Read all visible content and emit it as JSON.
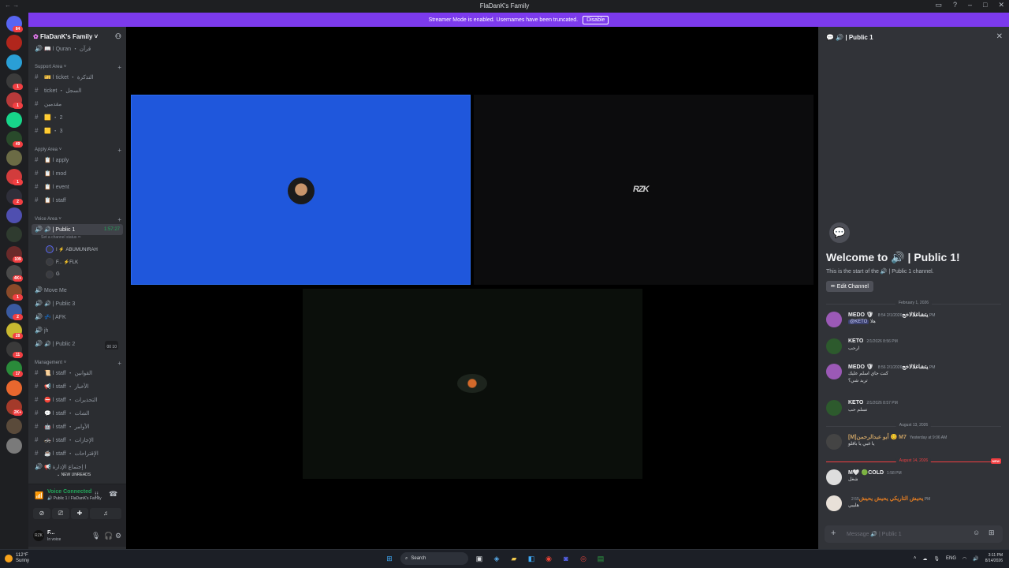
{
  "window": {
    "title": "FlaDanK's Family",
    "nav": "← →",
    "controls": [
      "▭",
      "?",
      "–",
      "□",
      "✕"
    ]
  },
  "banner": {
    "text": "Streamer Mode is enabled. Usernames have been truncated.",
    "button": "Disable"
  },
  "servers": [
    {
      "badge": "84",
      "color": "#5865f2"
    },
    {
      "badge": "",
      "color": "#b1261c"
    },
    {
      "badge": "",
      "color": "#2a9fd6"
    },
    {
      "badge": "1",
      "color": "#3b3b3b"
    },
    {
      "badge": "1",
      "color": "#b73a3a"
    },
    {
      "badge": "",
      "color": "#17d58a"
    },
    {
      "badge": "49",
      "color": "#294a2b"
    },
    {
      "badge": "",
      "color": "#6b6b45"
    },
    {
      "badge": "1",
      "color": "#d23c3c"
    },
    {
      "badge": "2",
      "color": "#2f2f3a"
    },
    {
      "badge": "",
      "color": "#4f4fb0"
    },
    {
      "badge": "",
      "color": "#2f3b2f"
    },
    {
      "badge": "109",
      "color": "#6a2a2a"
    },
    {
      "badge": "4K+",
      "color": "#4a4a4a"
    },
    {
      "badge": "1",
      "color": "#8a4a2a"
    },
    {
      "badge": "2",
      "color": "#3a5aa0"
    },
    {
      "badge": "28",
      "color": "#c8b830"
    },
    {
      "badge": "11",
      "color": "#3a3a3a"
    },
    {
      "badge": "17",
      "color": "#2a8a3a"
    },
    {
      "badge": "",
      "color": "#e8672e"
    },
    {
      "badge": "2K+",
      "color": "#a43a2a"
    },
    {
      "badge": "",
      "color": "#5a4a3a"
    },
    {
      "badge": "",
      "color": "#7a7a7a"
    }
  ],
  "sidebar": {
    "server_name": "FlaDanK's Family",
    "invite_icon": "add-user-icon",
    "top_channel": {
      "prefix": "🔊",
      "name": "📖 ا Quran ・ قرآن"
    },
    "categories": [
      {
        "name": "Support Area",
        "channels": [
          {
            "prefix": "#",
            "name": "🎫 ا ticket ・ التذكرة"
          },
          {
            "prefix": "#",
            "name": "ticket ・ السجل"
          },
          {
            "prefix": "#",
            "name": "مقدمين"
          },
          {
            "prefix": "#",
            "name": "🟨 ・ 2"
          },
          {
            "prefix": "#",
            "name": "🟨 ・ 3"
          }
        ]
      },
      {
        "name": "Apply Area",
        "channels": [
          {
            "prefix": "#",
            "name": "📋 ا apply"
          },
          {
            "prefix": "#",
            "name": "📋 ا mod"
          },
          {
            "prefix": "#",
            "name": "📋 ا event"
          },
          {
            "prefix": "#",
            "name": "📋 ا staff"
          }
        ]
      },
      {
        "name": "Voice Area",
        "channels": []
      },
      {
        "name": "Management",
        "channels": [
          {
            "prefix": "#",
            "name": "📜 ا staff ・ القوانين"
          },
          {
            "prefix": "#",
            "name": "📢 ا staff ・ الأخبار"
          },
          {
            "prefix": "#",
            "name": "⛔ ا staff ・ التحذيرات"
          },
          {
            "prefix": "#",
            "name": "💬 ا staff ・ الشات"
          },
          {
            "prefix": "#",
            "name": "🤖 ا staff ・ الأوامر"
          },
          {
            "prefix": "#",
            "name": "🚓 ا staff ・ الإجازات"
          },
          {
            "prefix": "#",
            "name": "☕ ا staff ・ الإقتراحات"
          },
          {
            "prefix": "🔊",
            "name": "📢 ا إجتماع الإدارة"
          }
        ]
      }
    ],
    "active_voice": {
      "name": "🔊 | Public 1",
      "timer": "1:57:27",
      "status": "Set a channel status ✏",
      "users": [
        "ا ⚡ ABUMUNIRAH",
        "F... ⚡FLK",
        "G"
      ]
    },
    "other_voice": [
      {
        "name": "Move Me"
      },
      {
        "name": "🔊 | Public 3"
      },
      {
        "name": "💤 | AFK"
      },
      {
        "name": "jh"
      },
      {
        "name": "🔊 | Public 2",
        "limit": "00 10"
      }
    ],
    "new_unreads": "NEW UNREADS"
  },
  "voice_panel": {
    "title": "Voice Connected",
    "subtitle": "🔊 Public 1 / FlaDanK's Family"
  },
  "user": {
    "name": "F...",
    "status": "In voice",
    "avatar_text": "RZK"
  },
  "stage": {
    "rzk_logo": "RZK"
  },
  "chat": {
    "header": "🔊 | Public 1",
    "welcome": "Welcome to 🔊 | Public 1!",
    "welcome_sub": "This is the start of the 🔊 | Public 1 channel.",
    "edit_channel": "✏ Edit Channel",
    "dates": {
      "d1": "February 1, 2026",
      "d2": "August 13, 2026",
      "d3": "August 14, 2026",
      "new": "NEW"
    },
    "messages": [
      {
        "author": "MEDO 🛡 يتشاغلالاخج",
        "time": "2/1/2026 8:54 PM",
        "line1": "هلا",
        "mention": "@KETO",
        "color": "#9b59b6"
      },
      {
        "author": "KETO",
        "time": "2/1/2026 8:56 PM",
        "line1": "ارحب",
        "color": "#2d5a2d"
      },
      {
        "author": "MEDO 🛡 يتشاغلالاخج",
        "time": "2/1/2026 8:56 PM",
        "line1": "كنت جاي اسلم عليك",
        "line2": "تريد شي؟",
        "color": "#9b59b6"
      },
      {
        "author": "KETO",
        "time": "2/1/2026 8:57 PM",
        "line1": "تسلم حب",
        "color": "#2d5a2d"
      },
      {
        "author": "[M]أبو عبدالرحمن 😊 M7",
        "time": "Yesterday at 9:06 AM",
        "line1": "يا غبي يا باقلو",
        "color": "#444",
        "author_color": "#c8a064"
      },
      {
        "author": "M🤍 🟢COLD",
        "time": "1:58 PM",
        "line1": "شغل",
        "color": "#ddd"
      },
      {
        "author": "يحيش التاريكي يحيش يحيش",
        "time": "2:55 PM",
        "line1": "هلييي",
        "color": "#e8e0d8",
        "author_color": "#e67e22"
      }
    ],
    "composer_placeholder": "Message 🔊 | Public 1"
  },
  "taskbar": {
    "weather": {
      "temp": "112°F",
      "cond": "Sunny"
    },
    "search": "Search",
    "lang": "ENG",
    "time": "3:11 PM",
    "date": "8/14/2026"
  }
}
